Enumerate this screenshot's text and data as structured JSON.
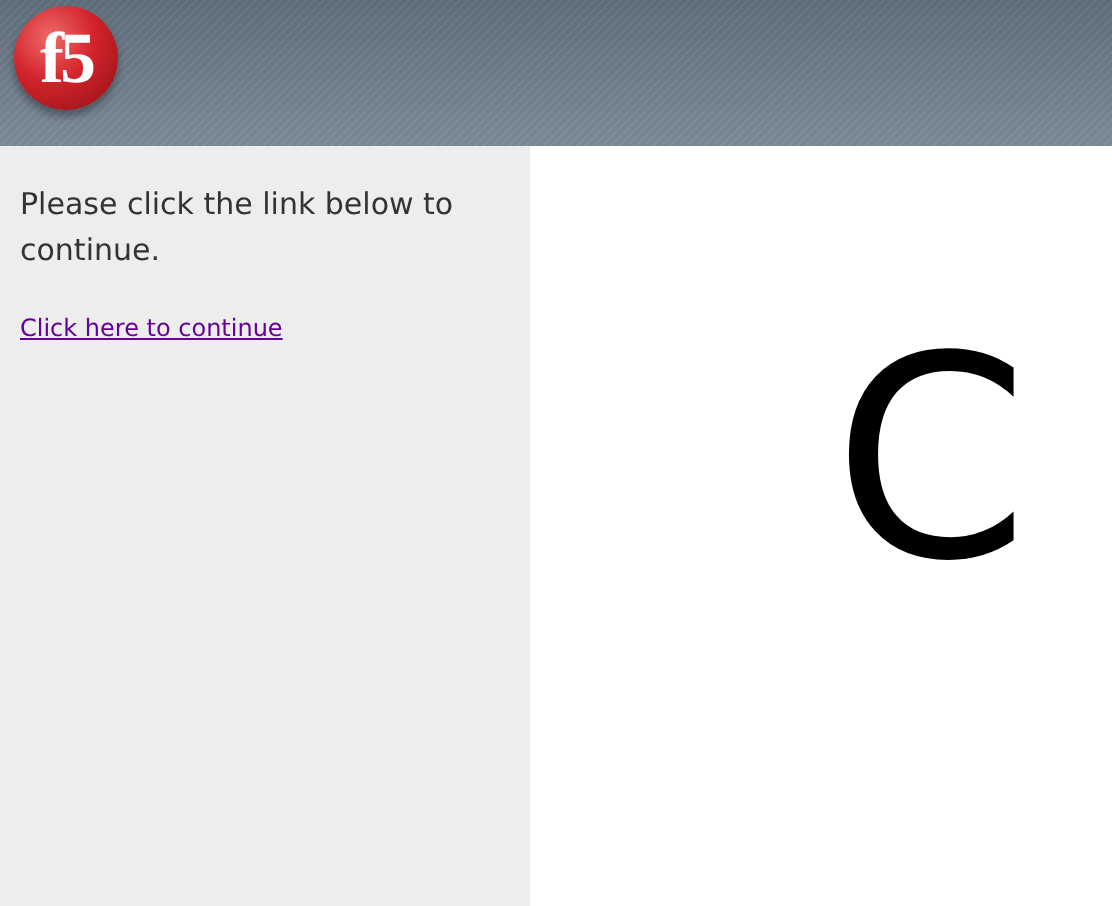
{
  "header": {
    "logo_text": "f5"
  },
  "sidebar": {
    "message": "Please click the link below to continue.",
    "link": "Click here to continue"
  },
  "main": {
    "letter": "C"
  }
}
